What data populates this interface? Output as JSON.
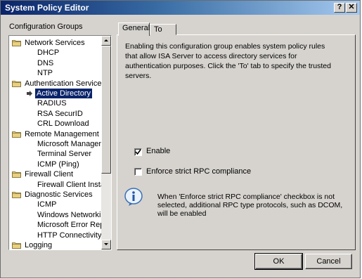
{
  "window": {
    "title": "System Policy Editor",
    "help_label": "?",
    "close_label": "✕"
  },
  "sidebar": {
    "label": "Configuration Groups",
    "items": [
      {
        "label": "Network Services",
        "kind": "group"
      },
      {
        "label": "DHCP",
        "kind": "child"
      },
      {
        "label": "DNS",
        "kind": "child"
      },
      {
        "label": "NTP",
        "kind": "child"
      },
      {
        "label": "Authentication Services",
        "kind": "group"
      },
      {
        "label": "Active Directory",
        "kind": "child",
        "selected": true
      },
      {
        "label": "RADIUS",
        "kind": "child"
      },
      {
        "label": "RSA SecurID",
        "kind": "child"
      },
      {
        "label": "CRL Download",
        "kind": "child"
      },
      {
        "label": "Remote Management",
        "kind": "group"
      },
      {
        "label": "Microsoft Manageme",
        "kind": "child"
      },
      {
        "label": "Terminal Server",
        "kind": "child"
      },
      {
        "label": "ICMP (Ping)",
        "kind": "child"
      },
      {
        "label": "Firewall Client",
        "kind": "group"
      },
      {
        "label": "Firewall Client Install",
        "kind": "child"
      },
      {
        "label": "Diagnostic Services",
        "kind": "group"
      },
      {
        "label": "ICMP",
        "kind": "child"
      },
      {
        "label": "Windows Networking",
        "kind": "child"
      },
      {
        "label": "Microsoft Error Repo",
        "kind": "child"
      },
      {
        "label": "HTTP Connectivity v",
        "kind": "child"
      },
      {
        "label": "Logging",
        "kind": "group"
      }
    ]
  },
  "tabs": [
    {
      "label": "General"
    },
    {
      "label": "To"
    }
  ],
  "general": {
    "description": "Enabling this configuration group enables system policy rules that allow ISA Server to access directory services for authentication purposes. Click the 'To' tab to specify the trusted servers.",
    "enable_label": "Enable",
    "enable_checked": true,
    "rpc_label": "Enforce strict RPC compliance",
    "rpc_checked": false,
    "note": "When 'Enforce strict RPC compliance' checkbox is not selected, additional RPC type protocols, such as DCOM, will be enabled"
  },
  "buttons": {
    "ok": "OK",
    "cancel": "Cancel"
  }
}
